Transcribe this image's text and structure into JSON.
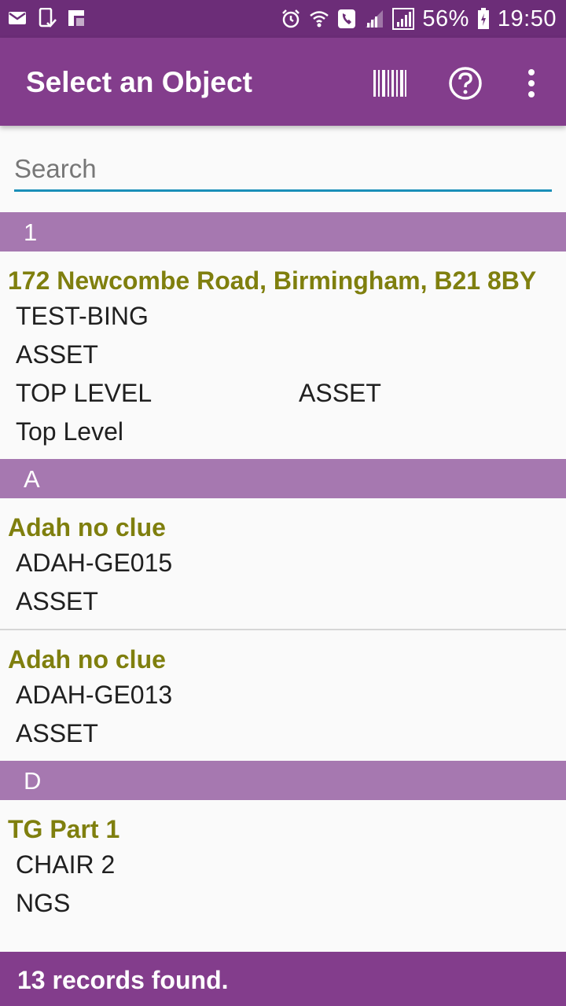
{
  "status_bar": {
    "battery": "56%",
    "time": "19:50",
    "icons": [
      "mail-icon",
      "device-check-icon",
      "app-icon",
      "alarm-icon",
      "wifi-icon",
      "call-icon",
      "signal-icon",
      "signal-icon-2",
      "battery-icon"
    ]
  },
  "app_bar": {
    "title": "Select an Object",
    "actions": [
      "barcode-scan-icon",
      "help-icon",
      "more-vert-icon"
    ]
  },
  "search": {
    "placeholder": "Search",
    "value": ""
  },
  "sections": [
    {
      "header": "1",
      "items": [
        {
          "title": "172 Newcombe Road, Birmingham, B21 8BY",
          "code": "TEST-BING",
          "type": "ASSET",
          "level": "TOP LEVEL",
          "level_type": "ASSET",
          "extra": "Top Level"
        }
      ]
    },
    {
      "header": "A",
      "items": [
        {
          "title": "Adah no clue",
          "code": "ADAH-GE015",
          "type": "ASSET"
        },
        {
          "title": "Adah no clue",
          "code": "ADAH-GE013",
          "type": "ASSET"
        }
      ]
    },
    {
      "header": "D",
      "items": [
        {
          "title": "TG Part 1",
          "code": "CHAIR 2",
          "type": "NGS"
        }
      ]
    }
  ],
  "footer": {
    "text": "13 records found."
  },
  "colors": {
    "status_bar": "#6c2d78",
    "app_bar": "#833d8c",
    "section_header": "#a678b0",
    "item_title": "#7f7f0e",
    "search_underline": "#1a8fb8"
  }
}
